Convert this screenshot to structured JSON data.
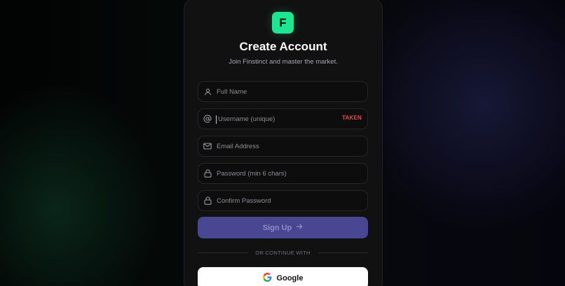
{
  "brand": {
    "logo_letter": "F",
    "accent": "#1ee58f"
  },
  "header": {
    "title": "Create Account",
    "subtitle": "Join Finstinct and master the market."
  },
  "form": {
    "full_name": {
      "placeholder": "Full Name",
      "icon": "user-icon"
    },
    "username": {
      "placeholder": "Username (unique)",
      "icon": "at-icon",
      "status": "TAKEN",
      "status_color": "#e5484d"
    },
    "email": {
      "placeholder": "Email Address",
      "icon": "mail-icon"
    },
    "password": {
      "placeholder": "Password (min 6 chars)",
      "icon": "lock-icon"
    },
    "confirm_password": {
      "placeholder": "Confirm Password",
      "icon": "lock-icon"
    },
    "submit_label": "Sign Up",
    "submit_color": "#4a4792"
  },
  "divider_text": "OR CONTINUE WITH",
  "oauth": {
    "google_label": "Google"
  }
}
